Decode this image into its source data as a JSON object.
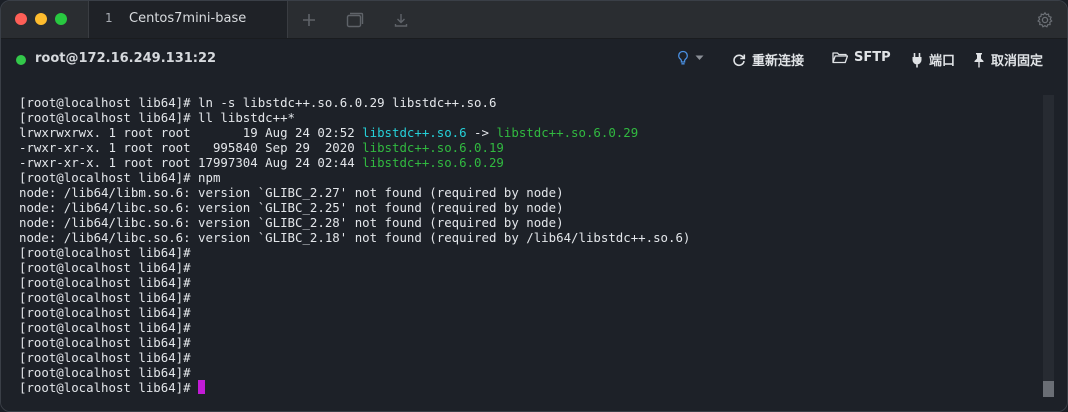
{
  "tabs": [
    {
      "index": "1",
      "title": "Centos7mini-base"
    }
  ],
  "session": {
    "host": "root@172.16.249.131:22",
    "status_color": "#33c84a"
  },
  "toolbar": {
    "reconnect_label": "重新连接",
    "sftp_label": "SFTP",
    "port_label": "端口",
    "unpin_label": "取消固定"
  },
  "icons": [
    "plus-icon",
    "windows-icon",
    "download-icon",
    "gear-icon",
    "lightbulb-icon",
    "chevron-down-icon",
    "refresh-icon",
    "folder-icon",
    "plug-icon",
    "pin-icon"
  ],
  "terminal": {
    "lines": [
      [
        {
          "text": "[root@localhost lib64]# ln -s libstdc++.so.6.0.29 libstdc++.so.6"
        }
      ],
      [
        {
          "text": "[root@localhost lib64]# ll libstdc++*"
        }
      ],
      [
        {
          "text": "lrwxrwxrwx. 1 root root       19 Aug 24 02:52 "
        },
        {
          "text": "libstdc++.so.6",
          "color": "cyan"
        },
        {
          "text": " -> "
        },
        {
          "text": "libstdc++.so.6.0.29",
          "color": "green"
        }
      ],
      [
        {
          "text": "-rwxr-xr-x. 1 root root   995840 Sep 29  2020 "
        },
        {
          "text": "libstdc++.so.6.0.19",
          "color": "green"
        }
      ],
      [
        {
          "text": "-rwxr-xr-x. 1 root root 17997304 Aug 24 02:44 "
        },
        {
          "text": "libstdc++.so.6.0.29",
          "color": "green"
        }
      ],
      [
        {
          "text": "[root@localhost lib64]# npm"
        }
      ],
      [
        {
          "text": "node: /lib64/libm.so.6: version `GLIBC_2.27' not found (required by node)"
        }
      ],
      [
        {
          "text": "node: /lib64/libc.so.6: version `GLIBC_2.25' not found (required by node)"
        }
      ],
      [
        {
          "text": "node: /lib64/libc.so.6: version `GLIBC_2.28' not found (required by node)"
        }
      ],
      [
        {
          "text": "node: /lib64/libc.so.6: version `GLIBC_2.18' not found (required by /lib64/libstdc++.so.6)"
        }
      ],
      [
        {
          "text": "[root@localhost lib64]#"
        }
      ],
      [
        {
          "text": "[root@localhost lib64]#"
        }
      ],
      [
        {
          "text": "[root@localhost lib64]#"
        }
      ],
      [
        {
          "text": "[root@localhost lib64]#"
        }
      ],
      [
        {
          "text": "[root@localhost lib64]#"
        }
      ],
      [
        {
          "text": "[root@localhost lib64]#"
        }
      ],
      [
        {
          "text": "[root@localhost lib64]#"
        }
      ],
      [
        {
          "text": "[root@localhost lib64]#"
        }
      ],
      [
        {
          "text": "[root@localhost lib64]#"
        }
      ],
      [
        {
          "text": "[root@localhost lib64]# ",
          "cursor": true
        }
      ]
    ],
    "cursor_color": "#c21bd6"
  }
}
